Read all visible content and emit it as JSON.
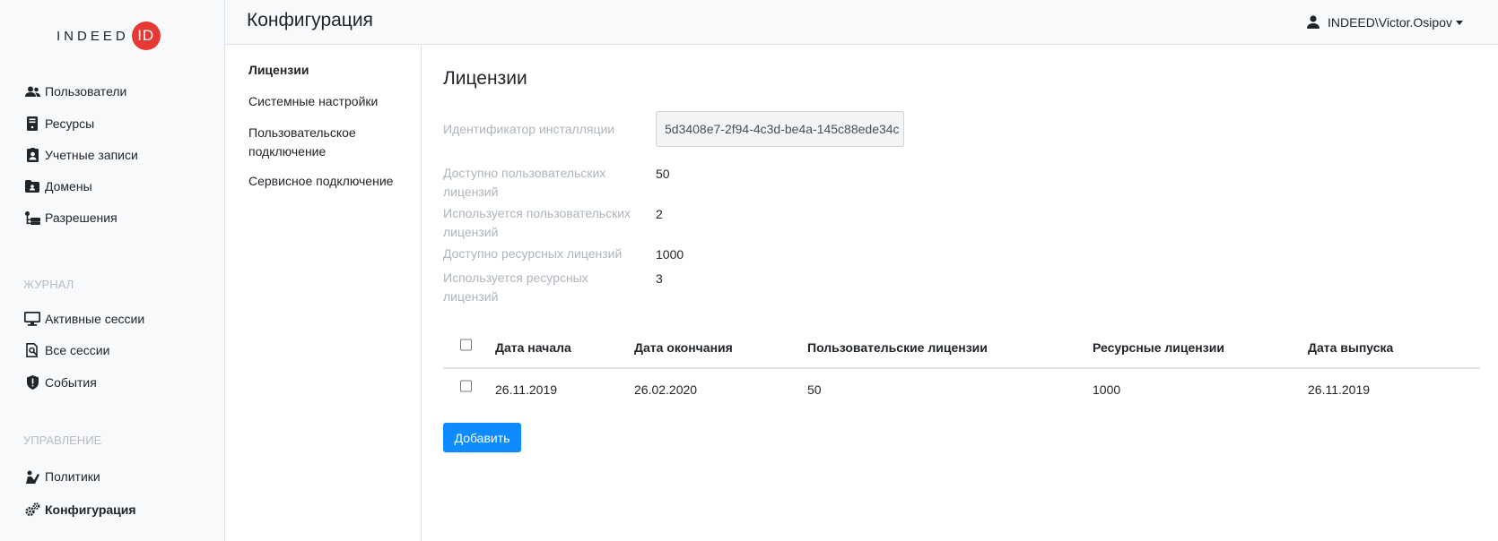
{
  "brand": {
    "logo_text": "INDEED",
    "logo_badge": "ID",
    "badge_color": "#e53935"
  },
  "sidebar": {
    "items": [
      {
        "label": "Пользователи",
        "icon": "users-icon"
      },
      {
        "label": "Ресурсы",
        "icon": "server-icon"
      },
      {
        "label": "Учетные записи",
        "icon": "id-badge-icon"
      },
      {
        "label": "Домены",
        "icon": "folder-user-icon"
      },
      {
        "label": "Разрешения",
        "icon": "permissions-icon"
      }
    ],
    "journal_title": "ЖУРНАЛ",
    "journal_items": [
      {
        "label": "Активные сессии",
        "icon": "monitor-icon"
      },
      {
        "label": "Все сессии",
        "icon": "search-document-icon"
      },
      {
        "label": "События",
        "icon": "shield-alert-icon"
      }
    ],
    "management_title": "УПРАВЛЕНИЕ",
    "management_items": [
      {
        "label": "Политики",
        "icon": "policy-icon"
      },
      {
        "label": "Конфигурация",
        "icon": "gears-icon"
      }
    ]
  },
  "header": {
    "title": "Конфигурация",
    "user": "INDEED\\Victor.Osipov"
  },
  "subnav": {
    "items": [
      "Лицензии",
      "Системные настройки",
      "Пользовательское подключение",
      "Сервисное подключение"
    ]
  },
  "main": {
    "title": "Лицензии",
    "install_id_label": "Идентификатор инсталляции",
    "install_id_value": "5d3408e7-2f94-4c3d-be4a-145c88ede34c",
    "fields": [
      {
        "label": "Доступно пользовательских лицензий",
        "value": "50"
      },
      {
        "label": "Используется пользовательских лицензий",
        "value": "2"
      },
      {
        "label": "Доступно ресурсных лицензий",
        "value": "1000"
      },
      {
        "label": "Используется ресурсных лицензий",
        "value": "3"
      }
    ],
    "table": {
      "columns": [
        "Дата начала",
        "Дата окончания",
        "Пользовательские лицензии",
        "Ресурсные лицензии",
        "Дата выпуска"
      ],
      "rows": [
        [
          "26.11.2019",
          "26.02.2020",
          "50",
          "1000",
          "26.11.2019"
        ]
      ]
    },
    "add_button": "Добавить",
    "accent_color": "#0d8bff"
  }
}
